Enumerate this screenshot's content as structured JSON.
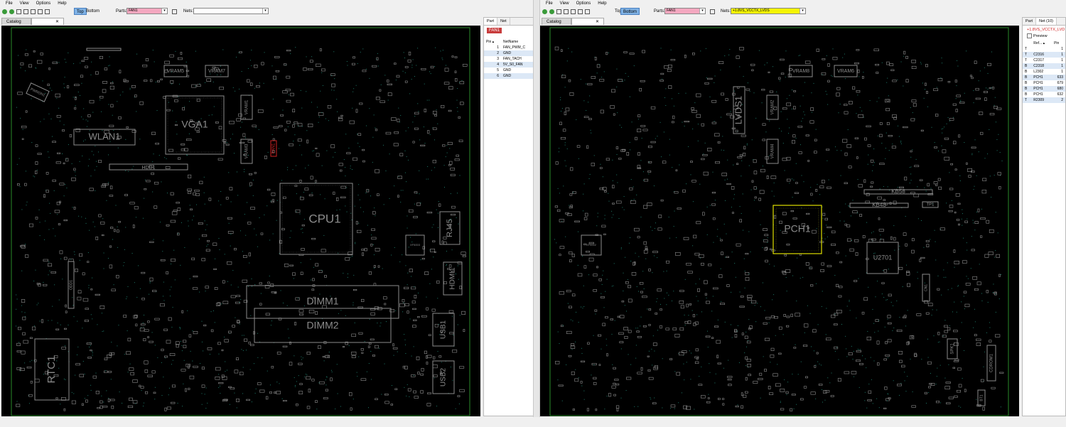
{
  "menu": [
    "File",
    "View",
    "Options",
    "Help"
  ],
  "left": {
    "side_top": "Top",
    "side_bottom": "Bottom",
    "parts_label": "Parts:",
    "parts_value": "FAN1",
    "nets_label": "Nets:",
    "nets_value": "",
    "tab_catalog": "Catalog",
    "tab_close": "✕",
    "panel_tab_part": "Part",
    "panel_tab_net": "Net",
    "part_badge": "FAN1",
    "pin_header": "Pin",
    "net_header": "NetName",
    "pins": [
      {
        "pin": "1",
        "net": "FAN_PWM_C"
      },
      {
        "pin": "2",
        "net": "GND"
      },
      {
        "pin": "3",
        "net": "FAN_TACH"
      },
      {
        "pin": "4",
        "net": "5V_S0_FAN"
      },
      {
        "pin": "5",
        "net": "GND"
      },
      {
        "pin": "6",
        "net": "GND"
      }
    ],
    "labels": {
      "wlan": "WLAN1",
      "vga": "VGA1",
      "hdd": "HDD1",
      "vram5": "VRAM5",
      "vram7": "VRAM7",
      "vram1": "VRAM1",
      "vram3": "VRAM3",
      "cpu": "CPU1",
      "dimm1": "DIMM1",
      "dimm2": "DIMM2",
      "rtc": "RTC1",
      "rj45": "RJ45",
      "hdmi": "HDMI1",
      "usb1": "USB1",
      "usb2": "USB2",
      "fan": "FAN1",
      "xf": "XF5003",
      "odd": "ODD1",
      "pwr": "PWRON1"
    }
  },
  "right": {
    "side_top": "Top",
    "side_bottom": "Bottom",
    "parts_label": "Parts:",
    "parts_value": "FAN1",
    "nets_label": "Nets:",
    "nets_value": "+1.8VS_VCCTX_LVDS",
    "tab_catalog": "Catalog",
    "tab_close": "✕",
    "panel_tab_part": "Part",
    "panel_tab_net": "Net (10)",
    "net_title": "+1.8VS_VCCTX_LVD",
    "preview_label": "Preview",
    "ref_header": "Ref...",
    "pin_header": "Pin",
    "rows": [
      {
        "side": "T",
        "ref": "",
        "pin": "1"
      },
      {
        "side": "T",
        "ref": "C2316",
        "pin": "1"
      },
      {
        "side": "T",
        "ref": "C2317",
        "pin": "1"
      },
      {
        "side": "B",
        "ref": "C2318",
        "pin": "1"
      },
      {
        "side": "B",
        "ref": "L2302",
        "pin": "1"
      },
      {
        "side": "B",
        "ref": "PCH1",
        "pin": "633"
      },
      {
        "side": "B",
        "ref": "PCH1",
        "pin": "679"
      },
      {
        "side": "B",
        "ref": "PCH1",
        "pin": "680"
      },
      {
        "side": "B",
        "ref": "PCH1",
        "pin": "632"
      },
      {
        "side": "T",
        "ref": "R2309",
        "pin": "2"
      }
    ],
    "labels": {
      "lvds": "LVDS1",
      "vram8": "VRAM8",
      "vram6": "VRAM6",
      "vram2": "VRAM2",
      "vram4": "VRAM4",
      "pch": "PCH1",
      "u2701": "U2701",
      "kb58": "KB58",
      "kb48": "KB48",
      "tp1": "TP1",
      "spk": "SPK1",
      "cdrom": "CDROM1",
      "bt1": "BT1",
      "xf": "XF5002",
      "cn": "CN1"
    }
  },
  "colors": {
    "board": "#000000",
    "outline": "#2a8a2a",
    "silk": "#8c8c8c",
    "part_hl": "#cc2222",
    "net_hl": "#e0e000",
    "dots": "#1f7a6a"
  }
}
